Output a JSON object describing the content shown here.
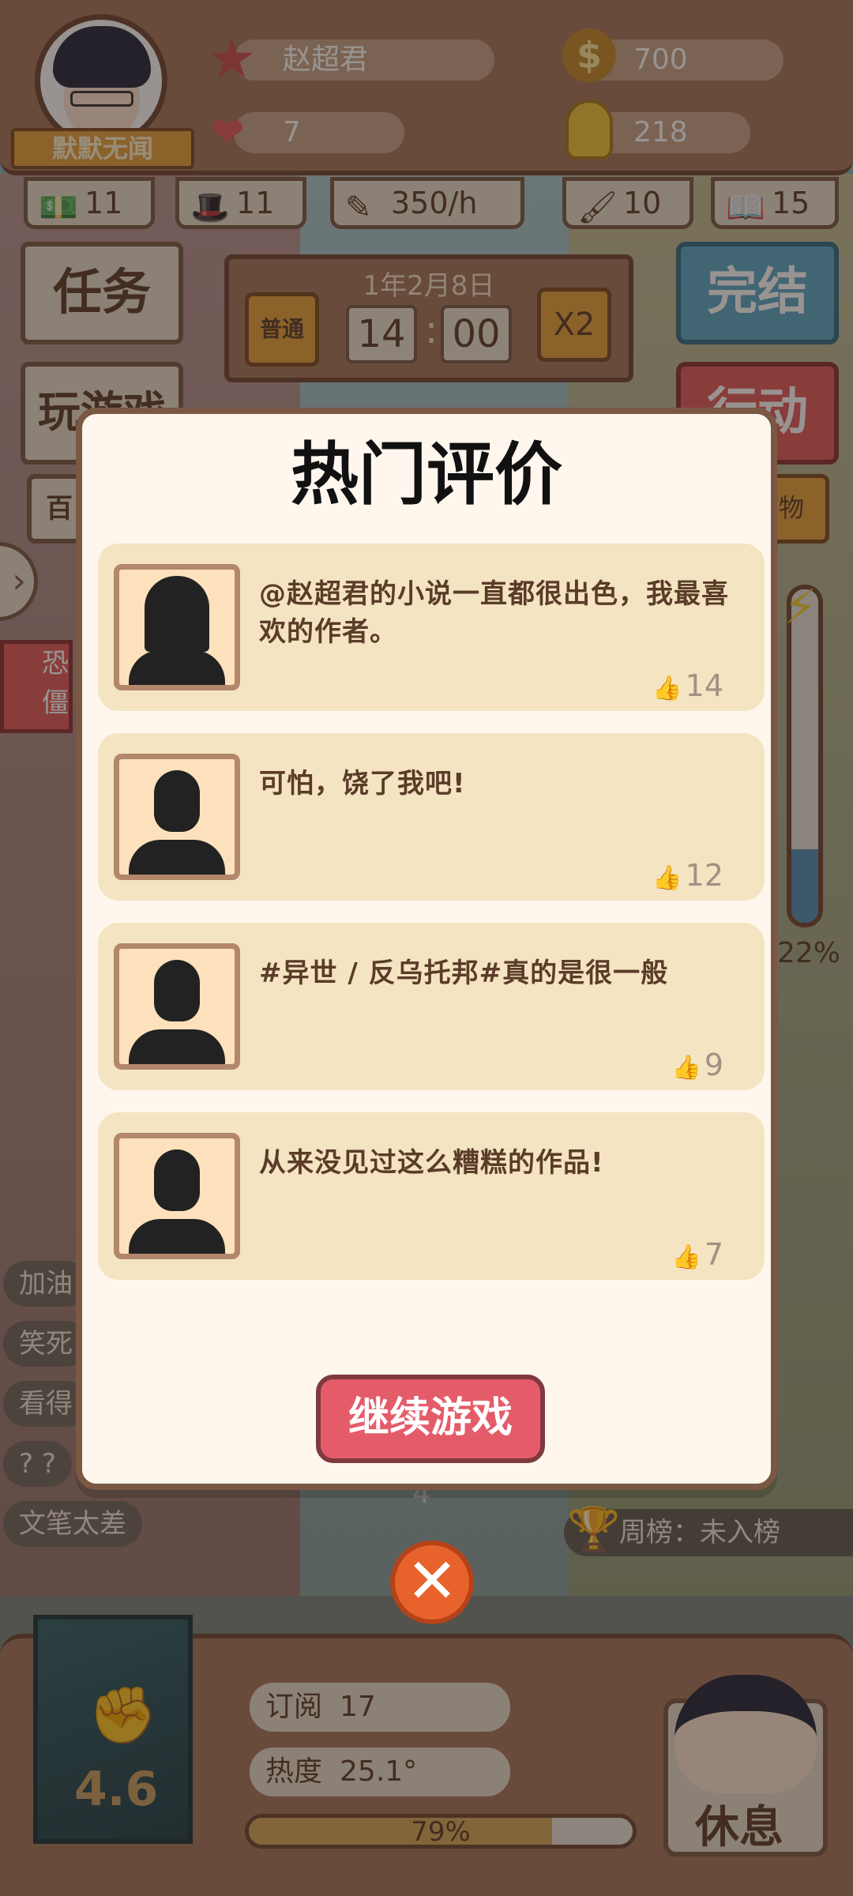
{
  "header": {
    "player_name": "赵超君",
    "player_title": "默默无闻",
    "likes": "7",
    "money": "700",
    "inspiration": "218",
    "stats": [
      {
        "icon": "money-pile-icon",
        "value": "11"
      },
      {
        "icon": "hat-icon",
        "value": "11"
      },
      {
        "icon": "pen-icon",
        "value": "350/h"
      },
      {
        "icon": "brush-icon",
        "value": "10"
      },
      {
        "icon": "book-icon",
        "value": "15"
      }
    ]
  },
  "left_buttons": {
    "task": "任务",
    "play": "玩游戏",
    "small": "百",
    "red": "恐 僵"
  },
  "time_panel": {
    "date": "1年2月8日",
    "mode": "普通",
    "hour": "14",
    "minute": "00",
    "speed": "X2"
  },
  "right_buttons": {
    "finish": "完结",
    "action": "行动",
    "items": "物"
  },
  "energy": {
    "percent_label": "22%",
    "level": 0.22
  },
  "side_chips": [
    "加油",
    "笑死",
    "看得",
    "? ?",
    "文笔太差"
  ],
  "weekly_rank": "周榜：未入榜",
  "under_number": "4",
  "modal": {
    "title": "热门评价",
    "reviews": [
      {
        "text": "@赵超君的小说一直都很出色，我最喜欢的作者。",
        "likes": "14",
        "avatar": "female-avatar-icon"
      },
      {
        "text": "可怕，饶了我吧!",
        "likes": "12",
        "avatar": "male-avatar-icon"
      },
      {
        "text": "#异世 / 反乌托邦#真的是很一般",
        "likes": "9",
        "avatar": "male-avatar-icon"
      },
      {
        "text": "从来没见过这么糟糕的作品!",
        "likes": "7",
        "avatar": "male-avatar-icon"
      }
    ],
    "continue_label": "继续游戏"
  },
  "bottom": {
    "book_score": "4.6",
    "subscribe_label": "订阅",
    "subscribe_value": "17",
    "heat_label": "热度",
    "heat_value": "25.1°",
    "progress_label": "79%",
    "progress": 0.79,
    "rest_label": "休息"
  }
}
